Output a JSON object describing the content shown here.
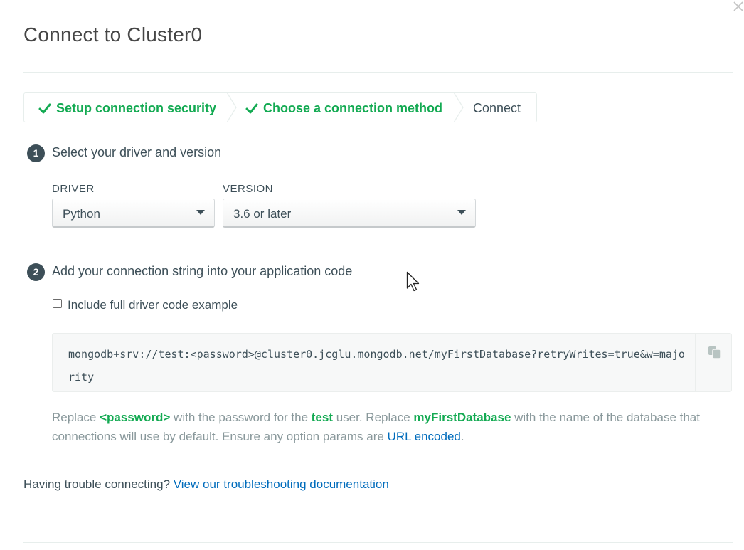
{
  "dialog": {
    "title": "Connect to Cluster0",
    "close_icon": "close-icon"
  },
  "stepper": {
    "steps": [
      {
        "label": "Setup connection security",
        "status": "complete",
        "icon": "checkmark-icon"
      },
      {
        "label": "Choose a connection method",
        "status": "complete",
        "icon": "checkmark-icon"
      },
      {
        "label": "Connect",
        "status": "current"
      }
    ]
  },
  "section1": {
    "number": "1",
    "title": "Select your driver and version",
    "driver_label": "DRIVER",
    "driver_value": "Python",
    "version_label": "VERSION",
    "version_value": "3.6 or later"
  },
  "section2": {
    "number": "2",
    "title": "Add your connection string into your application code",
    "checkbox_label": "Include full driver code example",
    "checkbox_checked": false,
    "connection_string": "mongodb+srv://test:<password>@cluster0.jcglu.mongodb.net/myFirstDatabase?retryWrites=true&w=majority",
    "copy_icon": "copy-icon",
    "help": {
      "t1": "Replace ",
      "password_token": "<password>",
      "t2": " with the password for the ",
      "user": "test",
      "t3": " user. Replace ",
      "database": "myFirstDatabase",
      "t4": " with the name of the database that connections will use by default. Ensure any option params are ",
      "url_link": "URL encoded",
      "t5": "."
    }
  },
  "footer": {
    "trouble_text": "Having trouble connecting? ",
    "trouble_link": "View our troubleshooting documentation"
  },
  "colors": {
    "accent_green": "#13aa52",
    "link_blue": "#006cbc",
    "text_dark": "#3d4f58",
    "text_muted": "#89989b"
  }
}
